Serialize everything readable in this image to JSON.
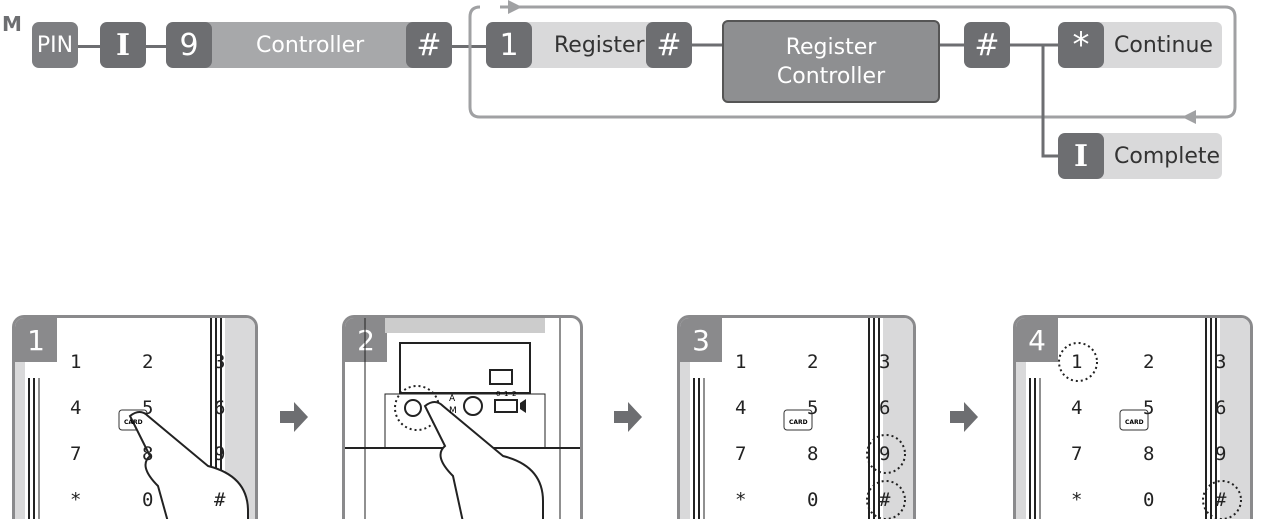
{
  "flow": {
    "mode_label": "M",
    "pin_key": "PIN",
    "i_key": "I",
    "nine_key": "9",
    "controller_label": "Controller",
    "hash_key": "#",
    "one_key": "1",
    "register_label": "Register",
    "register_controller_label": [
      "Register",
      "Controller"
    ],
    "star_key": "*",
    "continue_label": "Continue",
    "complete_label": "Complete"
  },
  "steps": [
    {
      "number": "1",
      "keys": [
        "1",
        "2",
        "3",
        "4",
        "5",
        "6",
        "7",
        "8",
        "9",
        "*",
        "0",
        "#"
      ],
      "card_label": "CARD"
    },
    {
      "number": "2",
      "switch_labels": [
        "0",
        "1",
        "2"
      ],
      "mode_labels": [
        "A",
        "M"
      ]
    },
    {
      "number": "3",
      "keys": [
        "1",
        "2",
        "3",
        "4",
        "5",
        "6",
        "7",
        "8",
        "9",
        "*",
        "0",
        "#"
      ],
      "card_label": "CARD",
      "highlighted": [
        "9",
        "#"
      ]
    },
    {
      "number": "4",
      "keys": [
        "1",
        "2",
        "3",
        "4",
        "5",
        "6",
        "7",
        "8",
        "9",
        "*",
        "0",
        "#"
      ],
      "card_label": "CARD",
      "highlighted": [
        "1",
        "#"
      ]
    }
  ],
  "colors": {
    "dark_key": "#6d6e71",
    "controller_band": "#a7a8aa",
    "light_band": "#d9d9da",
    "register_box": "#8e8f91"
  }
}
